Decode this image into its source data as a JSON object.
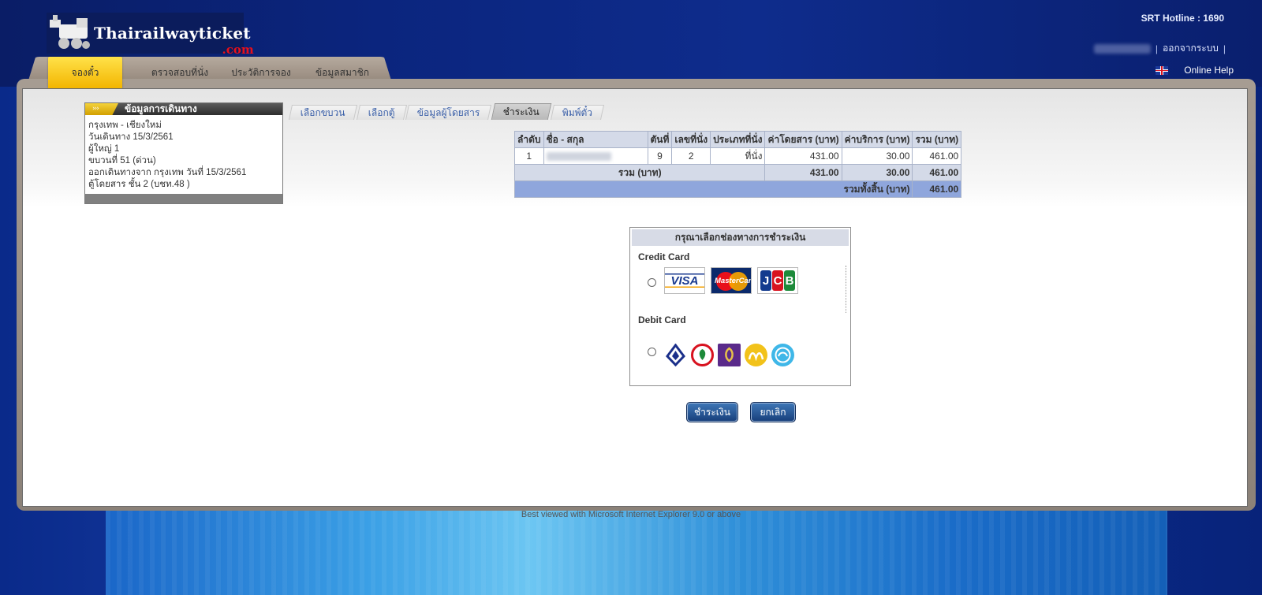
{
  "header": {
    "logo_main": "Thairailwayticket",
    "logo_sub": ".com",
    "hotline": "SRT Hotline : 1690",
    "logout": "ออกจากระบบ",
    "separator": "|",
    "online_help": "Online Help"
  },
  "nav": {
    "tabs": [
      {
        "label": "จองตั๋ว",
        "active": true
      },
      {
        "label": "ตรวจสอบที่นั่ง"
      },
      {
        "label": "ประวัติการจอง"
      },
      {
        "label": "ข้อมูลสมาชิก"
      }
    ]
  },
  "journey": {
    "title": "ข้อมูลการเดินทาง",
    "chevrons": "›››",
    "lines": [
      "กรุงเทพ - เชียงใหม่",
      "วันเดินทาง 15/3/2561",
      "ผู้ใหญ่ 1",
      "ขบวนที่ 51 (ด่วน)",
      "ออกเดินทางจาก กรุงเทพ วันที่ 15/3/2561",
      "ตู้โดยสาร ชั้น 2 (บชท.48 )"
    ]
  },
  "steps": [
    {
      "label": "เลือกขบวน"
    },
    {
      "label": "เลือกตู้"
    },
    {
      "label": "ข้อมูลผู้โดยสาร"
    },
    {
      "label": "ชำระเงิน",
      "current": true
    },
    {
      "label": "พิมพ์ตั๋ว"
    }
  ],
  "table": {
    "headers": [
      "ลำดับ",
      "ชื่อ - สกุล",
      "ตันที่",
      "เลขที่นั่ง",
      "ประเภทที่นั่ง",
      "ค่าโดยสาร (บาท)",
      "ค่าบริการ (บาท)",
      "รวม (บาท)"
    ],
    "row": {
      "no": "1",
      "car": "9",
      "seat": "2",
      "seat_type": "ที่นั่ง",
      "fare": "431.00",
      "service": "30.00",
      "total": "461.00"
    },
    "sum": {
      "label": "รวม (บาท)",
      "fare": "431.00",
      "service": "30.00",
      "total": "461.00"
    },
    "grand": {
      "label": "รวมทั้งสิ้น (บาท)",
      "total": "461.00"
    }
  },
  "payment": {
    "title": "กรุณาเลือกช่องทางการชำระเงิน",
    "credit_label": "Credit Card",
    "debit_label": "Debit Card",
    "visa": "VISA",
    "mastercard": "MasterCard",
    "jcb": [
      "J",
      "C",
      "B"
    ]
  },
  "buttons": {
    "pay": "ชำระเงิน",
    "cancel": "ยกเลิก"
  },
  "footer": "Best viewed with Microsoft Internet Explorer 9.0 or above",
  "colors": {
    "accent_yellow": "#f3b500",
    "header_blue": "#0b257e",
    "table_header": "#d4dae8",
    "table_grand": "#8fa6dc",
    "button": "#173e7a"
  }
}
